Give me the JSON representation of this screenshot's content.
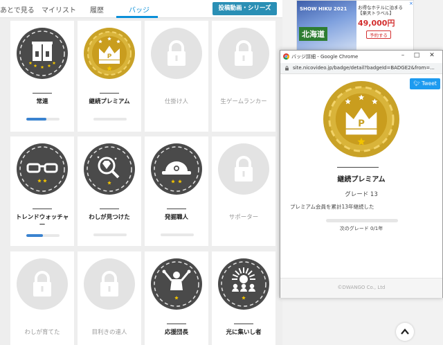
{
  "nav": {
    "tabs": [
      {
        "label": "あとで見る"
      },
      {
        "label": "マイリスト"
      },
      {
        "label": "履歴"
      },
      {
        "label": "バッジ",
        "active": true
      }
    ],
    "post_button": "投稿動画・シリーズ"
  },
  "badges": [
    {
      "name": "常連",
      "locked": false,
      "icon": "door-curtain-icon",
      "progress": 0.6
    },
    {
      "name": "継続プレミアム",
      "locked": false,
      "icon": "crown-icon",
      "progress": 0
    },
    {
      "name": "仕掛け人",
      "locked": true,
      "icon": "lock-icon"
    },
    {
      "name": "生ゲームランカー",
      "locked": true,
      "icon": "lock-icon"
    },
    {
      "name": "トレンドウォッチャー",
      "locked": false,
      "icon": "glasses-icon",
      "progress": 0.5
    },
    {
      "name": "わしが見つけた",
      "locked": false,
      "icon": "magnifier-diamond-icon",
      "progress": 0
    },
    {
      "name": "発掘職人",
      "locked": false,
      "icon": "miner-helmet-icon",
      "progress": 0
    },
    {
      "name": "サポーター",
      "locked": true,
      "icon": "lock-icon"
    },
    {
      "name": "わしが育てた",
      "locked": true,
      "icon": "lock-icon"
    },
    {
      "name": "目利きの達人",
      "locked": true,
      "icon": "lock-icon"
    },
    {
      "name": "応援団長",
      "locked": false,
      "icon": "cheerleader-icon"
    },
    {
      "name": "光に集いし者",
      "locked": false,
      "icon": "crowd-light-icon"
    }
  ],
  "ad": {
    "image_title": "SHOW HIKU 2021",
    "region": "北海道",
    "headline": "お得なホテルに泊まる",
    "sub": "【楽天トラベル】",
    "price": "49,000円",
    "reserve": "予約する",
    "close": "×"
  },
  "popup": {
    "window_title": "バッジ詳細 - Google Chrome",
    "url": "site.nicovideo.jp/badge/detail?badgeId=BADGE2&from=...",
    "tweet": "Tweet",
    "badge_name": "継続プレミアム",
    "grade": "グレード 13",
    "description": "プレミアム会員を累計13年継続した",
    "next_grade": "次のグレード 0/1年",
    "footer": "©DWANGO Co., Ltd"
  },
  "colors": {
    "accent": "#0a8fd8",
    "dark_badge": "#4a4a4a",
    "gold": "#c9a227",
    "locked_gray": "#e3e3e3",
    "star": "#f2c400"
  }
}
